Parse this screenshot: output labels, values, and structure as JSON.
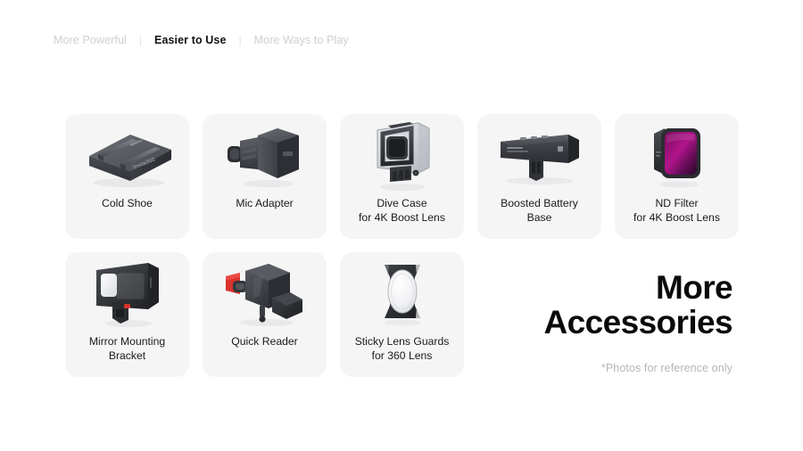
{
  "nav": {
    "items": [
      {
        "label": "More Powerful",
        "active": false
      },
      {
        "label": "Easier to Use",
        "active": true
      },
      {
        "label": "More Ways to Play",
        "active": false
      }
    ],
    "separator": "|"
  },
  "products": [
    {
      "name": "cold-shoe",
      "label": "Cold Shoe",
      "brand_mark": "Insta360",
      "accent": "#3a3d42"
    },
    {
      "name": "mic-adapter",
      "label": "Mic Adapter",
      "accent": "#3a3d42"
    },
    {
      "name": "dive-case",
      "label": "Dive Case\nfor 4K Boost Lens",
      "accent": "#3a3d42"
    },
    {
      "name": "boosted-battery-base",
      "label": "Boosted Battery\nBase",
      "accent": "#3a3d42"
    },
    {
      "name": "nd-filter",
      "label": "ND Filter\nfor 4K Boost Lens",
      "accent": "#9c0f79"
    },
    {
      "name": "mirror-mounting-bracket",
      "label": "Mirror Mounting\nBracket",
      "accent": "#2e3034"
    },
    {
      "name": "quick-reader",
      "label": "Quick Reader",
      "accent": "#d8332c"
    },
    {
      "name": "sticky-lens-guards",
      "label": "Sticky Lens Guards\nfor 360 Lens",
      "accent": "#2b2d31"
    }
  ],
  "headline": {
    "title": "More\nAccessories",
    "note": "*Photos for reference only"
  },
  "theme": {
    "page_background": "#ffffff",
    "card_background": "#f5f5f6",
    "text_primary": "#1b1b1b",
    "text_muted": "#b6b6b6",
    "nav_inactive": "#cfcfcf"
  }
}
